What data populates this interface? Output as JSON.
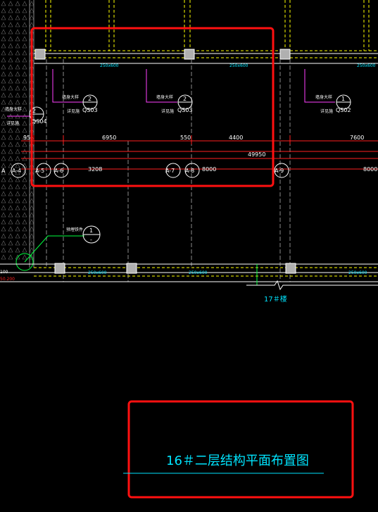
{
  "drawing": {
    "title": "16＃二层结构平面布置图",
    "building_label": "17＃楼",
    "colors": {
      "background": "#000000",
      "red": "#ff2020",
      "yellow": "#ffff00",
      "white": "#ffffff",
      "cyan": "#00e5ff",
      "green": "#00ff40",
      "grey": "#8a8a8a",
      "magenta": "#ff40ff",
      "highlight_red": "#ff1010"
    },
    "beam_labels": {
      "top_left": "250x600",
      "top_mid": "250x600",
      "top_right": "250x600",
      "bottom_left": "250x600",
      "bottom_mid": "250x600",
      "bottom_right": "250x600"
    },
    "section_callouts": [
      {
        "num": "2",
        "ref": "QS03",
        "note1": "墙身大样",
        "note2": "详见施"
      },
      {
        "num": "2",
        "ref": "QS03",
        "note1": "墙身大样",
        "note2": "详见施"
      },
      {
        "num": "1",
        "ref": "QS02",
        "note1": "墙身大样",
        "note2": "详见施"
      },
      {
        "num": "2",
        "ref": "QS04",
        "note1": "墙身大样",
        "note2": "详见施"
      }
    ],
    "detail_callout": {
      "num": "1",
      "ref": "-",
      "note": "预埋铁件"
    },
    "dims_upper": [
      "95",
      "6950",
      "550",
      "4400",
      "7600"
    ],
    "dim_total": "49950",
    "dims_lower": [
      "3208",
      "8000",
      "8000"
    ],
    "axes": [
      "A-4",
      "A-5",
      "A-6",
      "A-7",
      "A-8",
      "A-9"
    ],
    "axis_left_partial": "A",
    "level_mark": "50.200",
    "left_mark": "100"
  }
}
